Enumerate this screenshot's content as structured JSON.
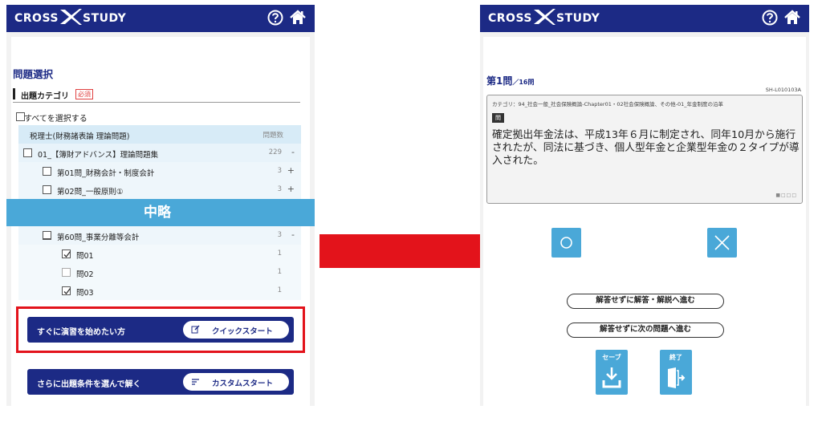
{
  "brand": {
    "left": "CROSS",
    "right": "STUDY"
  },
  "icons": {
    "help": "help-circle-icon",
    "home": "home-icon"
  },
  "colors": {
    "brand_navy": "#1c2a85",
    "accent_blue": "#4aa8d8",
    "highlight_red": "#e3131b"
  },
  "left": {
    "section_title": "問題選択",
    "category_label": "出題カテゴリ",
    "required_badge": "必須",
    "select_all_label": "すべてを選択する",
    "table_header": {
      "name": "税理士(財務諸表論 理論問題)",
      "count": "問題数"
    },
    "rows": [
      {
        "label": "01_【簿財アドバンス】理論問題集",
        "count": "229",
        "toggle": "-"
      },
      {
        "label": "第01問_財務会計・制度会計",
        "count": "3",
        "toggle": "+"
      },
      {
        "label": "第02問_一般原則①",
        "count": "3",
        "toggle": "+"
      },
      {
        "label": "第60問_事業分離等会計",
        "count": "3",
        "toggle": "-"
      },
      {
        "label": "問01",
        "count": "1",
        "checked": true
      },
      {
        "label": "問02",
        "count": "1",
        "checked": false
      },
      {
        "label": "問03",
        "count": "1",
        "checked": true
      }
    ],
    "omission_label": "中略",
    "quick": {
      "text": "すぐに演習を始めたい方",
      "button": "クイックスタート"
    },
    "custom": {
      "text": "さらに出題条件を選んで解く",
      "button": "カスタムスタート"
    }
  },
  "right": {
    "question_number": "第1問",
    "question_total": "／16問",
    "question_id": "SH-L010103A",
    "category": "カテゴリ：94_社会一般_社会保険概論-Chapter01・02社会保険概論、その他-01_年金制度の沿革",
    "question_badge": "問",
    "question_text": "確定拠出年金法は、平成13年６月に制定され、同年10月から施行されたが、同法に基づき、個人型年金と企業型年金の２タイプが導入された。",
    "page_dots": "■□□□",
    "skip_to_answer": "解答せずに解答・解説へ進む",
    "skip_to_next": "解答せずに次の問題へ進む",
    "save_label": "セーブ",
    "exit_label": "終了"
  }
}
